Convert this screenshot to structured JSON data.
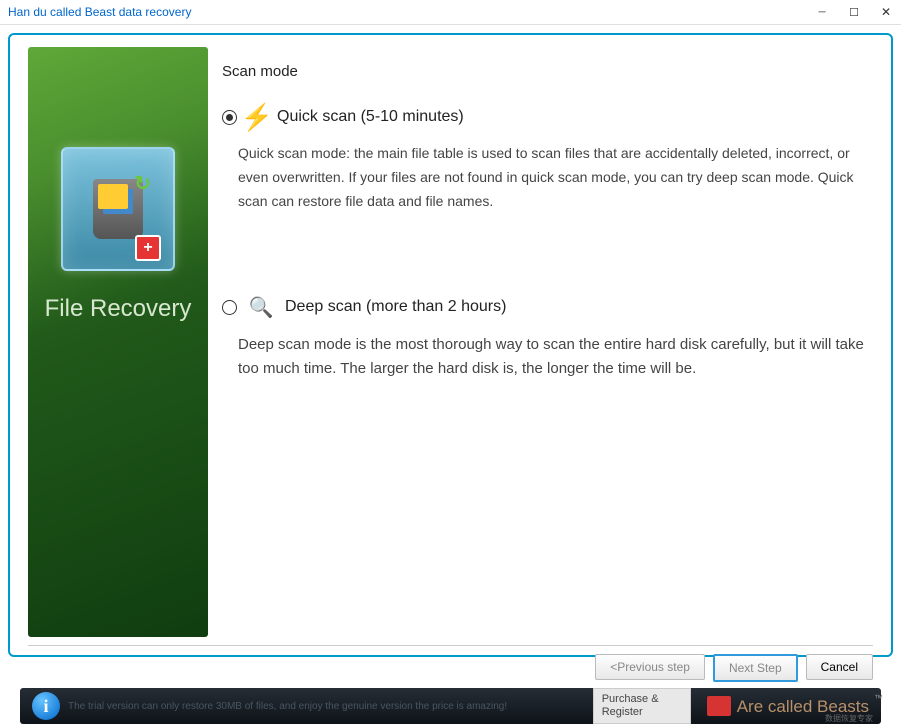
{
  "window": {
    "title": "Han du called Beast data recovery"
  },
  "sidebar": {
    "title": "File Recovery"
  },
  "main": {
    "heading": "Scan mode",
    "options": [
      {
        "label": "Quick scan (5-10 minutes)",
        "selected": true,
        "description": "Quick scan mode: the main file table is used to scan files that are accidentally deleted, incorrect, or even overwritten. If your files are not found in quick scan mode, you can try deep scan mode. Quick scan can restore file data and file names."
      },
      {
        "label": "Deep scan (more than 2 hours)",
        "selected": false,
        "description": "Deep scan mode is the most thorough way to scan the entire hard disk carefully, but it will take too much time. The larger the hard disk is, the longer the time will be."
      }
    ]
  },
  "buttons": {
    "prev": "<Previous step",
    "next": "Next Step",
    "cancel": "Cancel"
  },
  "footer": {
    "info_text": "The trial version can only restore 30MB of files, and enjoy the genuine version the price is amazing!",
    "purchase": "Purchase & Register",
    "brand": "Are called Beasts",
    "tm": "™"
  }
}
